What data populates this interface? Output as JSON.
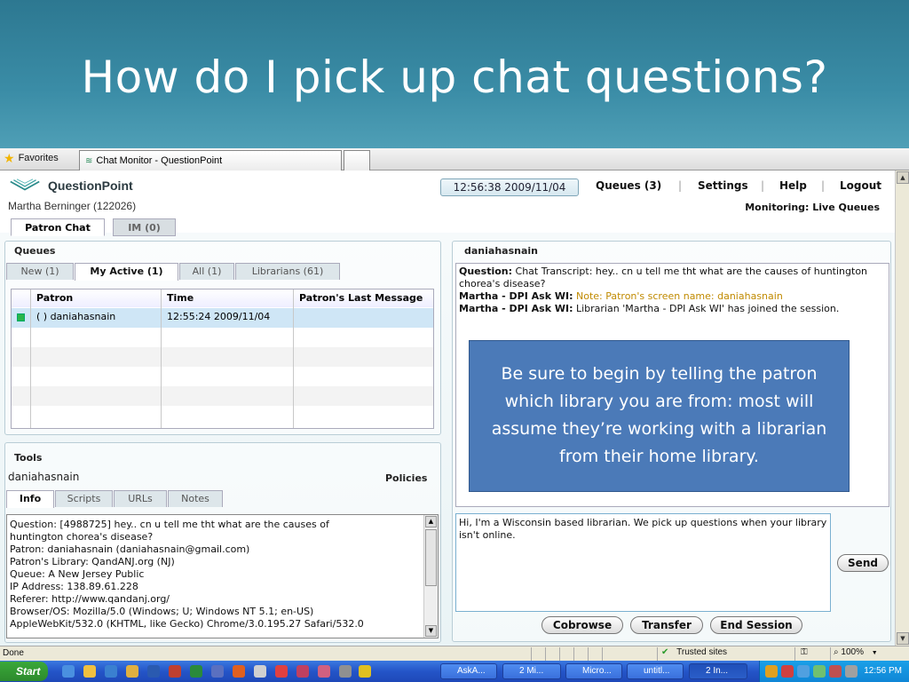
{
  "slide": {
    "title": "How do I pick up chat questions?"
  },
  "browser": {
    "favorites_label": "Favorites",
    "tab_title": "Chat Monitor - QuestionPoint"
  },
  "app": {
    "logo_text": "QuestionPoint",
    "user_name": "Martha Berninger (122026)",
    "clock": "12:56:38 2009/11/04",
    "nav": {
      "queues": "Queues (3)",
      "settings": "Settings",
      "help": "Help",
      "logout": "Logout"
    },
    "monitoring": "Monitoring: Live Queues",
    "main_tabs": {
      "patron_chat": "Patron Chat",
      "im": "IM (0)"
    }
  },
  "queues": {
    "title": "Queues",
    "tabs": {
      "new": "New (1)",
      "my_active": "My Active (1)",
      "all": "All (1)",
      "librarians": "Librarians (61)"
    },
    "columns": {
      "patron": "Patron",
      "time": "Time",
      "last_message": "Patron's Last Message"
    },
    "rows": [
      {
        "patron": "( ) daniahasnain",
        "time": "12:55:24 2009/11/04",
        "last_message": ""
      }
    ]
  },
  "tools": {
    "title": "Tools",
    "patron": "daniahasnain",
    "policies": "Policies",
    "tabs": {
      "info": "Info",
      "scripts": "Scripts",
      "urls": "URLs",
      "notes": "Notes"
    },
    "info_lines": {
      "l1": "Question: [4988725] hey.. cn u tell me tht what are the causes of",
      "l2": "huntington chorea's disease?",
      "l3": "Patron: daniahasnain (daniahasnain@gmail.com)",
      "l4": "Patron's Library: QandANJ.org (NJ)",
      "l5": "Queue: A New Jersey Public",
      "l6": "IP Address: 138.89.61.228",
      "l7": "Referer: http://www.qandanj.org/",
      "l8": "Browser/OS: Mozilla/5.0 (Windows; U; Windows NT 5.1; en-US)",
      "l9": "AppleWebKit/532.0 (KHTML, like Gecko) Chrome/3.0.195.27 Safari/532.0"
    }
  },
  "chat": {
    "title": "daniahasnain",
    "transcript": {
      "q_label": "Question:",
      "q_text": "Chat Transcript: hey.. cn u tell me tht what are the causes of huntington chorea's disease?",
      "m1_label": "Martha - DPI Ask WI:",
      "m1_text": "Note: Patron's screen name: daniahasnain",
      "m2_label": "Martha - DPI Ask WI:",
      "m2_text": "Librarian 'Martha - DPI Ask WI' has joined the session."
    },
    "callout": "Be sure to begin by telling the patron which library you are from: most will assume they’re working with a librarian from their home library.",
    "reply": "Hi, I'm a Wisconsin based librarian.  We pick up questions when your library isn't online.",
    "buttons": {
      "send": "Send",
      "cobrowse": "Cobrowse",
      "transfer": "Transfer",
      "end": "End Session"
    }
  },
  "statusbar": {
    "left": "Done",
    "zone": "Trusted sites",
    "zoom": "100%"
  },
  "taskbar": {
    "start": "Start",
    "windows": {
      "w1": "AskA...",
      "w2": "2 Mi...",
      "w3": "Micro...",
      "w4": "untitl...",
      "w5": "2 In..."
    },
    "time": "12:56 PM"
  },
  "colors": {
    "accent": "#4b7ab8",
    "note_text": "#c08a00",
    "slide_bg": "#3a8ca6"
  }
}
